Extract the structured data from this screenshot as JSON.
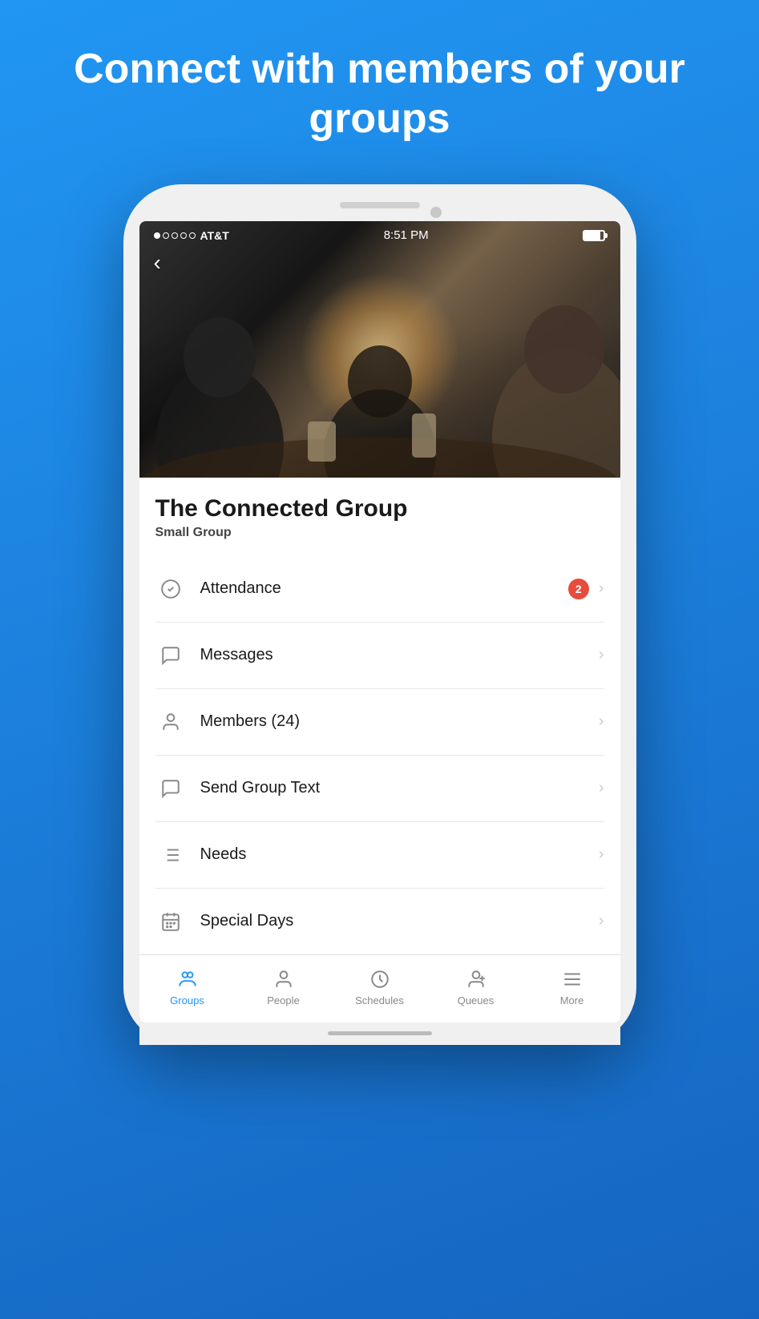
{
  "hero": {
    "title": "Connect with members of your groups"
  },
  "status_bar": {
    "carrier": "AT&T",
    "time": "8:51 PM"
  },
  "group": {
    "name": "The Connected Group",
    "type": "Small Group"
  },
  "menu_items": [
    {
      "id": "attendance",
      "label": "Attendance",
      "badge": "2",
      "icon": "check-circle"
    },
    {
      "id": "messages",
      "label": "Messages",
      "badge": null,
      "icon": "message-circle"
    },
    {
      "id": "members",
      "label": "Members (24)",
      "badge": null,
      "icon": "user"
    },
    {
      "id": "send-group-text",
      "label": "Send Group Text",
      "badge": null,
      "icon": "message-square"
    },
    {
      "id": "needs",
      "label": "Needs",
      "badge": null,
      "icon": "list"
    },
    {
      "id": "special-days",
      "label": "Special Days",
      "badge": null,
      "icon": "calendar"
    }
  ],
  "bottom_nav": [
    {
      "id": "groups",
      "label": "Groups",
      "active": true
    },
    {
      "id": "people",
      "label": "People",
      "active": false
    },
    {
      "id": "schedules",
      "label": "Schedules",
      "active": false
    },
    {
      "id": "queues",
      "label": "Queues",
      "active": false
    },
    {
      "id": "more",
      "label": "More",
      "active": false
    }
  ],
  "back_button": "‹"
}
